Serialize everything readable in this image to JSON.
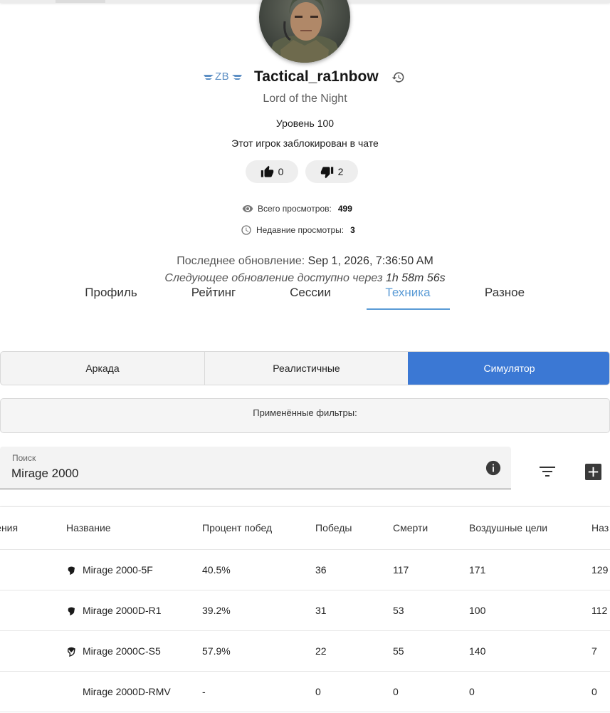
{
  "profile": {
    "clan_tag": "ZB",
    "nickname": "Tactical_ra1nbow",
    "title": "Lord of the Night",
    "level": "Уровень 100",
    "chat_status": "Этот игрок заблокирован в чате",
    "likes": "0",
    "dislikes": "2"
  },
  "views": {
    "total_label": "Всего просмотров:",
    "total_value": "499",
    "recent_label": "Недавние просмотры:",
    "recent_value": "3"
  },
  "update": {
    "last_label": "Последнее обновление:",
    "last_value": "Sep 1, 2026, 7:36:50 AM",
    "next_label": "Следующее обновление доступно через",
    "next_value": "1h 58m 56s"
  },
  "tabs": [
    {
      "label": "Профиль"
    },
    {
      "label": "Рейтинг"
    },
    {
      "label": "Сессии"
    },
    {
      "label": "Техника",
      "active": true
    },
    {
      "label": "Разное"
    }
  ],
  "modes": [
    {
      "label": "Аркада"
    },
    {
      "label": "Реалистичные"
    },
    {
      "label": "Симулятор",
      "active": true
    }
  ],
  "filters_label": "Применённые фильтры:",
  "search": {
    "label": "Поиск",
    "value": "Mirage 2000"
  },
  "table": {
    "headers": [
      "дения",
      "Название",
      "Процент побед",
      "Победы",
      "Смерти",
      "Воздушные цели",
      "Наз"
    ],
    "rows": [
      {
        "name": "Mirage 2000-5F",
        "icon": "shield-solid-icon",
        "winrate": "40.5%",
        "wins": "36",
        "deaths": "117",
        "air": "171",
        "ground": "129"
      },
      {
        "name": "Mirage 2000D-R1",
        "icon": "shield-solid-icon",
        "winrate": "39.2%",
        "wins": "31",
        "deaths": "53",
        "air": "100",
        "ground": "112"
      },
      {
        "name": "Mirage 2000C-S5",
        "icon": "shield-half-icon",
        "winrate": "57.9%",
        "wins": "22",
        "deaths": "55",
        "air": "140",
        "ground": "7"
      },
      {
        "name": "Mirage 2000D-RMV",
        "icon": "",
        "winrate": "-",
        "wins": "0",
        "deaths": "0",
        "air": "0",
        "ground": "0"
      }
    ]
  },
  "colors": {
    "accent": "#3b78d4",
    "tab_active": "#5a9bd6",
    "clan": "#5d8fc4"
  }
}
